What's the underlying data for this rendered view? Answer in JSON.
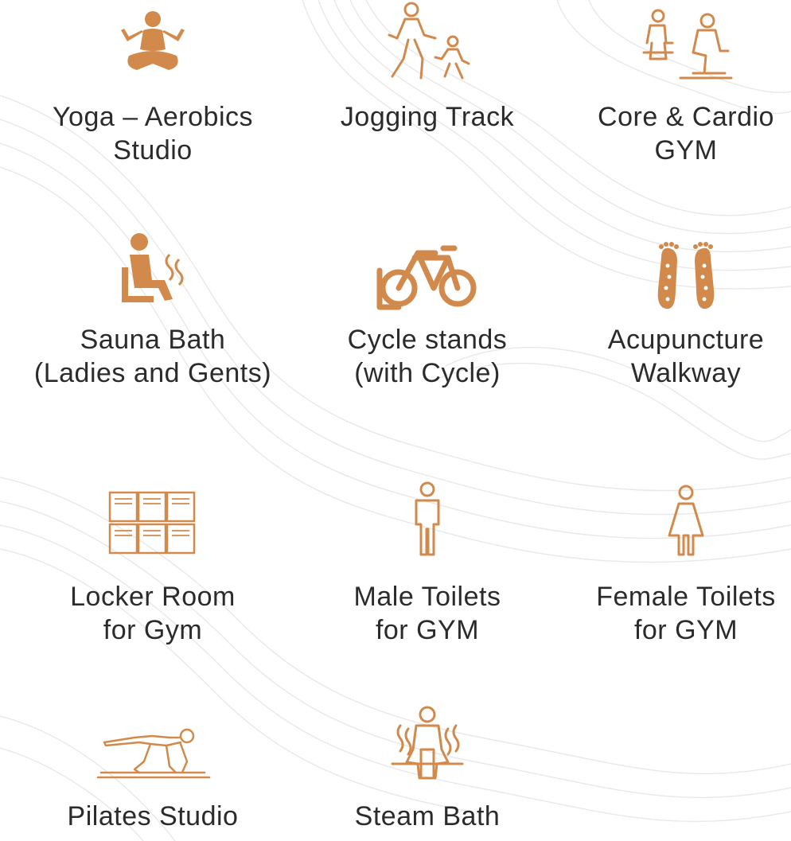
{
  "colors": {
    "accent": "#D28A4C",
    "text": "#2B2B2B",
    "background_lines": "#E9E9E9"
  },
  "amenities": [
    {
      "icon": "yoga-icon",
      "line1": "Yoga – Aerobics",
      "line2": "Studio"
    },
    {
      "icon": "jogging-icon",
      "line1": "Jogging Track",
      "line2": ""
    },
    {
      "icon": "gym-icon",
      "line1": "Core & Cardio",
      "line2": "GYM"
    },
    {
      "icon": "sauna-icon",
      "line1": "Sauna Bath",
      "line2": "(Ladies and Gents)"
    },
    {
      "icon": "bicycle-icon",
      "line1": "Cycle stands",
      "line2": "(with Cycle)"
    },
    {
      "icon": "footprints-icon",
      "line1": "Acupuncture",
      "line2": "Walkway"
    },
    {
      "icon": "locker-icon",
      "line1": "Locker Room",
      "line2": "for Gym"
    },
    {
      "icon": "male-icon",
      "line1": "Male Toilets",
      "line2": "for GYM"
    },
    {
      "icon": "female-icon",
      "line1": "Female Toilets",
      "line2": "for GYM"
    },
    {
      "icon": "pilates-icon",
      "line1": "Pilates Studio",
      "line2": ""
    },
    {
      "icon": "steam-icon",
      "line1": "Steam Bath",
      "line2": ""
    }
  ]
}
